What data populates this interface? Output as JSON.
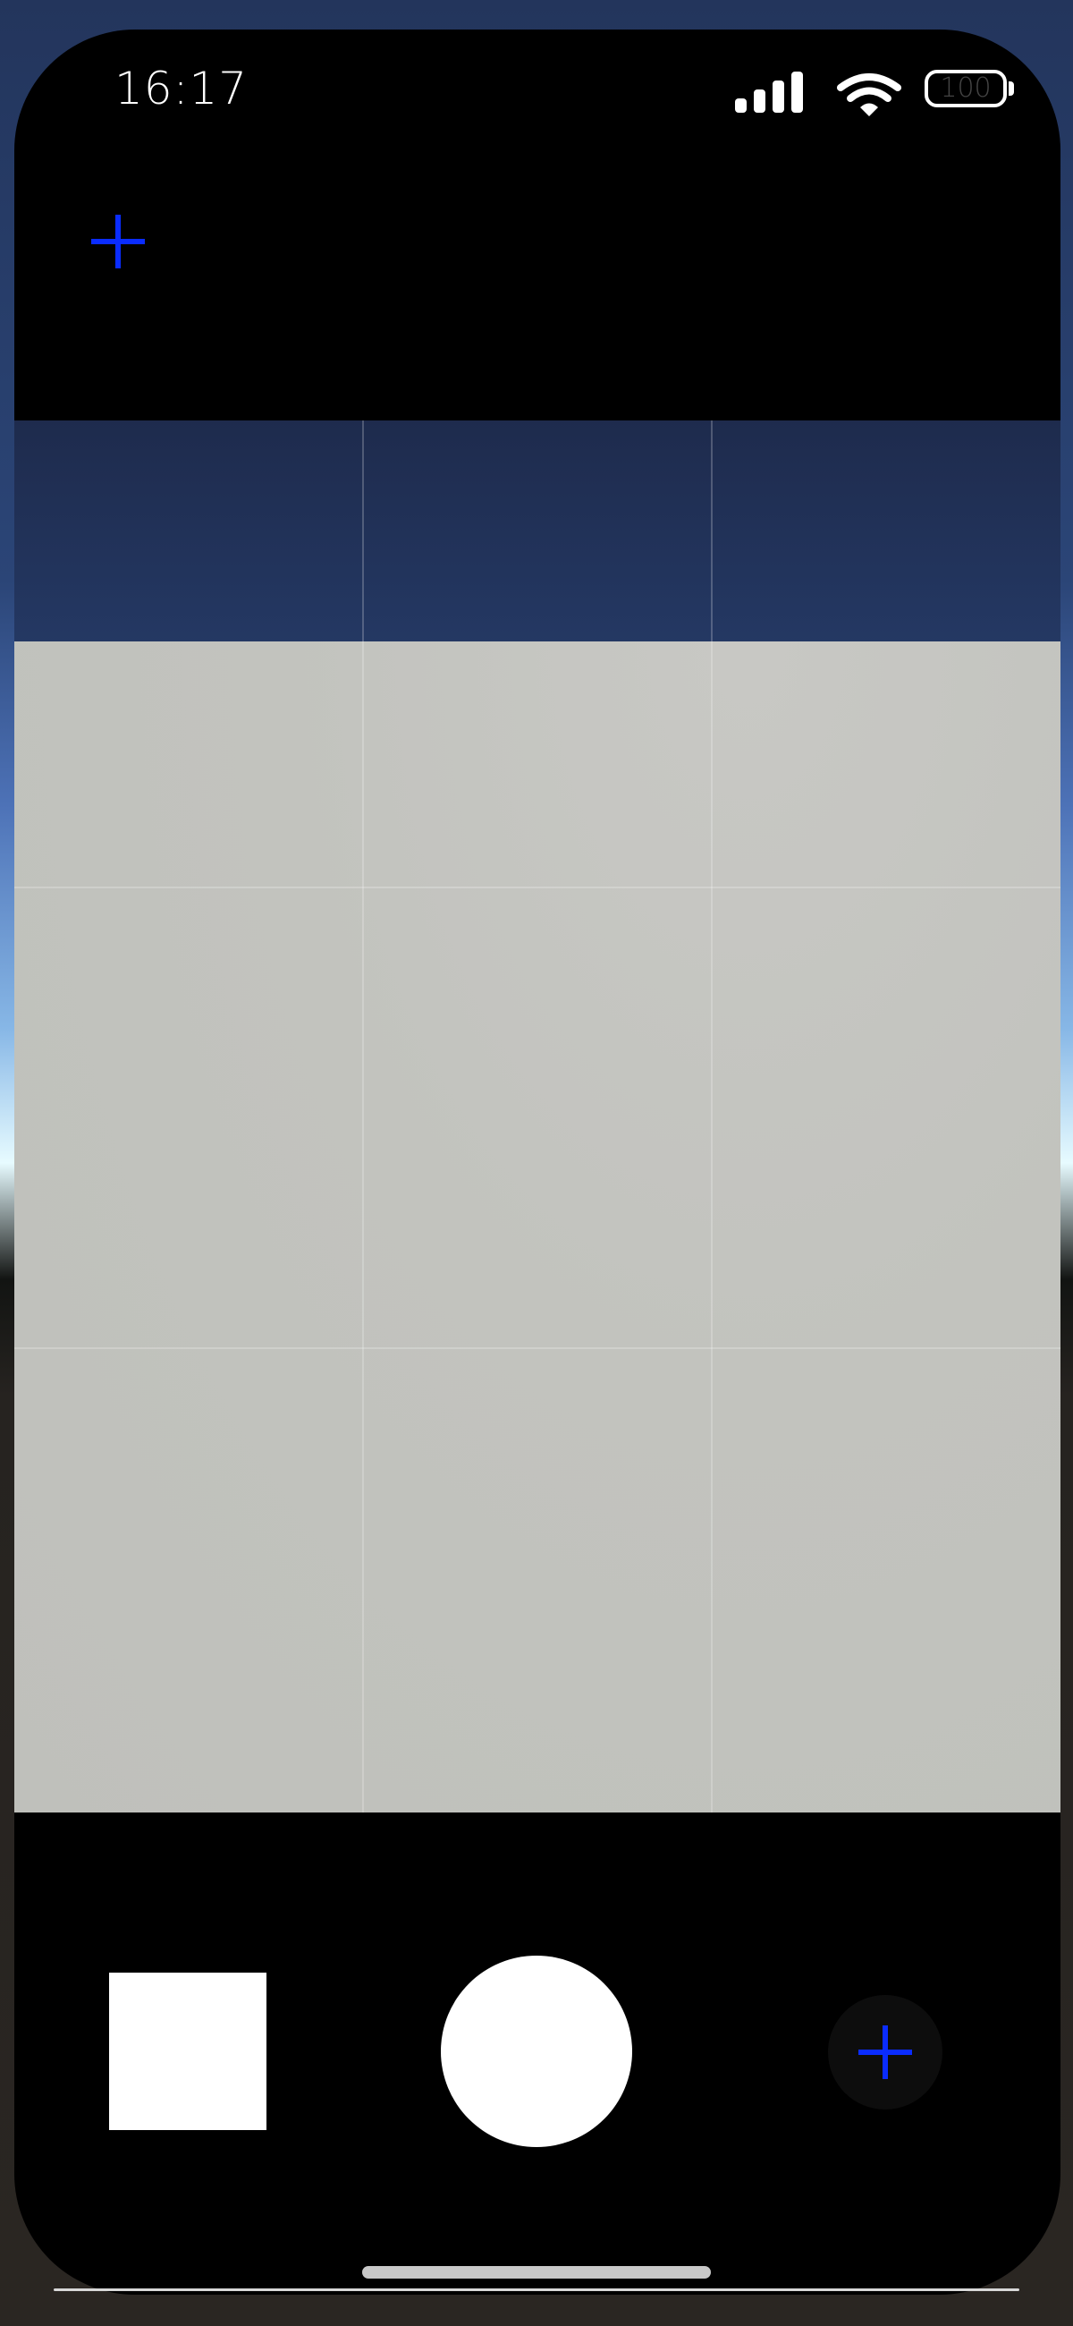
{
  "status_bar": {
    "time": "16:17",
    "battery_level": "100",
    "signal_icon": "cellular-signal-icon",
    "wifi_icon": "wifi-icon",
    "battery_icon": "battery-icon"
  },
  "toolbar": {
    "top_button_icon": "plus-icon"
  },
  "controls": {
    "thumbnail_icon": "photo-thumbnail",
    "shutter_icon": "shutter-button",
    "right_button_icon": "plus-icon"
  },
  "colors": {
    "accent": "#0a2cff",
    "background": "#000000",
    "shutter": "#ffffff"
  }
}
